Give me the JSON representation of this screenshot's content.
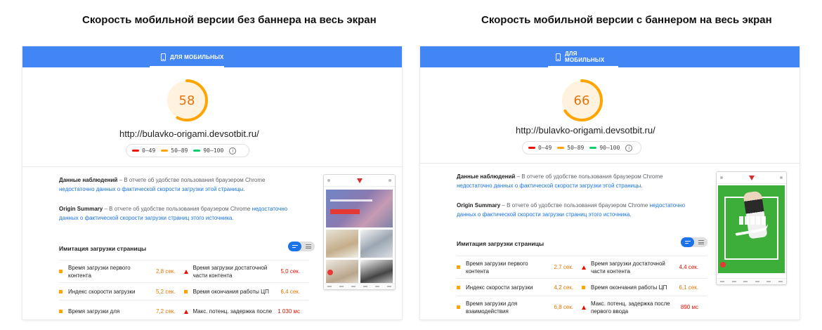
{
  "headings": {
    "left": "Скорость мобильной версии без баннера на весь экран",
    "right": "Скорость мобильной версии с баннером на весь экран"
  },
  "colors": {
    "topbar": "#4285f4",
    "fail": "#eb0f00",
    "average": "#e67700",
    "pass": "#0cce6b",
    "average_fill": "#ffa400",
    "link": "#1a73e8"
  },
  "legend": {
    "fail": "0–49",
    "average": "50–89",
    "pass": "90–100",
    "info_icon": "info-icon"
  },
  "panels": [
    {
      "tab_label": "ДЛЯ МОБИЛЬНЫХ",
      "tab_icon": "phone-icon",
      "score": 58,
      "url": "http://bulavko-origami.devsotbit.ru/",
      "field_data": {
        "title": "Данные наблюдений",
        "text": " – В отчете об удобстве пользования браузером Chrome ",
        "link": "недостаточно данных о фактической скорости загрузки этой страницы."
      },
      "origin_summary": {
        "title": "Origin Summary",
        "text": " – В отчете об удобстве пользования браузером Chrome ",
        "link": "недостаточно данных о фактической скорости загрузки страниц этого источника."
      },
      "simulation_title": "Имитация загрузки страницы",
      "screenshot_type": "site-preview",
      "metrics": [
        {
          "label": "Время загрузки первого контента",
          "value": "2,8 сек.",
          "status": "average"
        },
        {
          "label": "Время загрузки достаточной части контента",
          "value": "5,0 сек.",
          "status": "fail"
        },
        {
          "label": "Индекс скорости загрузки",
          "value": "5,2 сек.",
          "status": "average"
        },
        {
          "label": "Время окончания работы ЦП",
          "value": "6,4 сек.",
          "status": "average"
        },
        {
          "label": "Время загрузки для",
          "value": "7,2 сек.",
          "status": "average"
        },
        {
          "label": "Макс. потенц. задержка после",
          "value": "1 030 мс",
          "status": "fail"
        }
      ]
    },
    {
      "tab_label": "ДЛЯ МОБИЛЬНЫХ",
      "tab_icon": "phone-icon",
      "score": 66,
      "url": "http://bulavko-origami.devsotbit.ru/",
      "field_data": {
        "title": "Данные наблюдений",
        "text": " – В отчете об удобстве пользования браузером Chrome ",
        "link": "недостаточно данных о фактической скорости загрузки этой страницы."
      },
      "origin_summary": {
        "title": "Origin Summary",
        "text": " – В отчете об удобстве пользования браузером Chrome ",
        "link": "недостаточно данных о фактической скорости загрузки страниц этого источника."
      },
      "simulation_title": "Имитация загрузки страницы",
      "screenshot_type": "nike-banner-preview",
      "metrics": [
        {
          "label": "Время загрузки первого контента",
          "value": "2,7 сек.",
          "status": "average"
        },
        {
          "label": "Время загрузки достаточной части контента",
          "value": "4,4 сек.",
          "status": "fail"
        },
        {
          "label": "Индекс скорости загрузки",
          "value": "4,2 сек.",
          "status": "average"
        },
        {
          "label": "Время окончания работы ЦП",
          "value": "6,1 сек.",
          "status": "average"
        },
        {
          "label": "Время загрузки для взаимодействия",
          "value": "6,8 сек.",
          "status": "average"
        },
        {
          "label": "Макс. потенц. задержка после первого ввода",
          "value": "890 мс",
          "status": "fail"
        }
      ]
    }
  ]
}
